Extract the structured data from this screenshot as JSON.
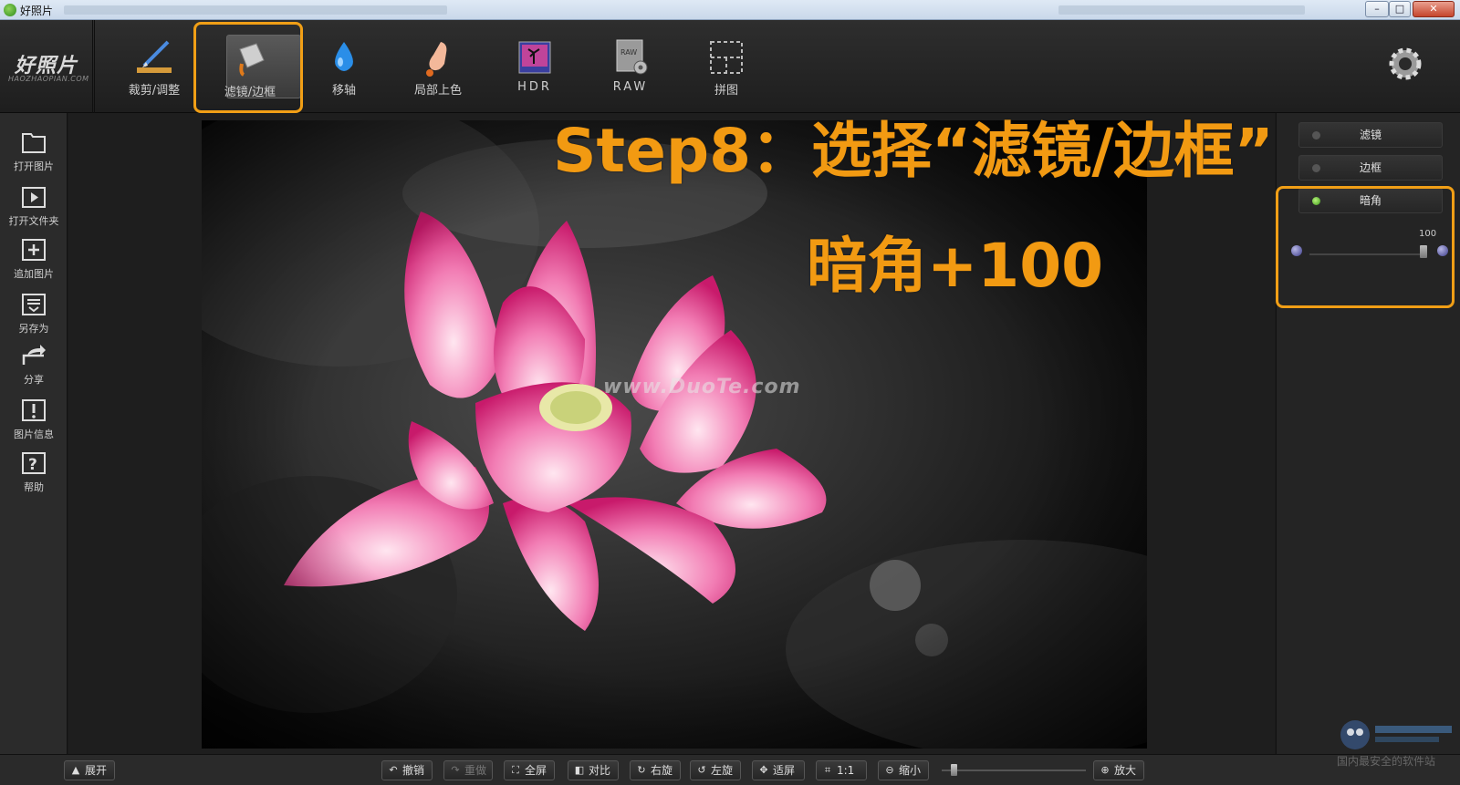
{
  "window": {
    "title": "好照片"
  },
  "logo": {
    "main": "好照片",
    "sub": "HAOZHAOPIAN.COM"
  },
  "toolbar": {
    "tools": [
      {
        "label": "裁剪/调整",
        "icon": "crop-ruler-icon"
      },
      {
        "label": "滤镜/边框",
        "icon": "paint-bucket-icon"
      },
      {
        "label": "移轴",
        "icon": "water-drop-icon"
      },
      {
        "label": "局部上色",
        "icon": "finger-paint-icon"
      },
      {
        "label": "HDR",
        "icon": "hdr-landscape-icon"
      },
      {
        "label": "RAW",
        "icon": "raw-file-icon"
      },
      {
        "label": "拼图",
        "icon": "collage-icon"
      }
    ],
    "active_index": 1,
    "settings_icon": "gear-icon"
  },
  "sidebar": {
    "items": [
      {
        "label": "打开图片",
        "icon": "folder-icon"
      },
      {
        "label": "打开文件夹",
        "icon": "play-folder-icon"
      },
      {
        "label": "追加图片",
        "icon": "add-image-icon"
      },
      {
        "label": "另存为",
        "icon": "save-as-icon"
      },
      {
        "label": "分享",
        "icon": "share-icon"
      },
      {
        "label": "图片信息",
        "icon": "info-icon"
      },
      {
        "label": "帮助",
        "icon": "help-icon"
      }
    ]
  },
  "canvas": {
    "watermark": "www.DuoTe.com"
  },
  "annotation": {
    "line1": "Step8：选择“滤镜/边框”，",
    "line2": "暗角+100",
    "color": "#f29a12"
  },
  "right_panel": {
    "buttons": [
      "滤镜",
      "边框",
      "暗角"
    ],
    "active_index": 2,
    "vignette_value": "100"
  },
  "bottom_bar": {
    "expand": "展开",
    "undo": "撤销",
    "redo": "重做",
    "fullscreen": "全屏",
    "compare": "对比",
    "rotate_right": "右旋",
    "rotate_left": "左旋",
    "fit": "适屏",
    "actual_size": "1:1",
    "zoom_out": "缩小",
    "zoom_in": "放大"
  },
  "site_badge": {
    "text": "国内最安全的软件站"
  },
  "colors": {
    "highlight": "#f19f16",
    "accent_green": "#3f9a18"
  }
}
